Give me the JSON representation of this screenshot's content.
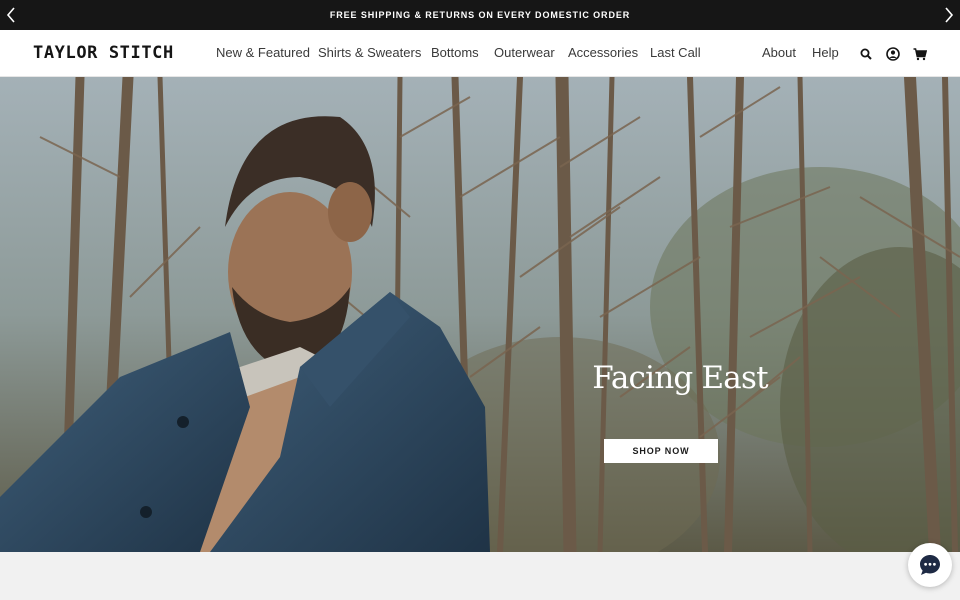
{
  "announcement": {
    "text": "FREE SHIPPING & RETURNS ON EVERY DOMESTIC ORDER",
    "prev_icon": "chevron-left-icon",
    "next_icon": "chevron-right-icon"
  },
  "header": {
    "logo": "TAYLOR STITCH",
    "nav": {
      "new_featured": "New & Featured",
      "shirts_sweaters": "Shirts & Sweaters",
      "bottoms": "Bottoms",
      "outerwear": "Outerwear",
      "accessories": "Accessories",
      "last_call": "Last Call",
      "about": "About",
      "help": "Help"
    },
    "icons": [
      "search-icon",
      "account-icon",
      "cart-icon"
    ]
  },
  "hero": {
    "title": "Facing East",
    "cta": "SHOP NOW"
  },
  "chat": {
    "icon": "chat-bubble-icon"
  },
  "colors": {
    "announcement_bg": "#161616",
    "header_bg": "#ffffff",
    "below_bg": "#f1f1f1",
    "chat_icon": "#1e2a44"
  }
}
